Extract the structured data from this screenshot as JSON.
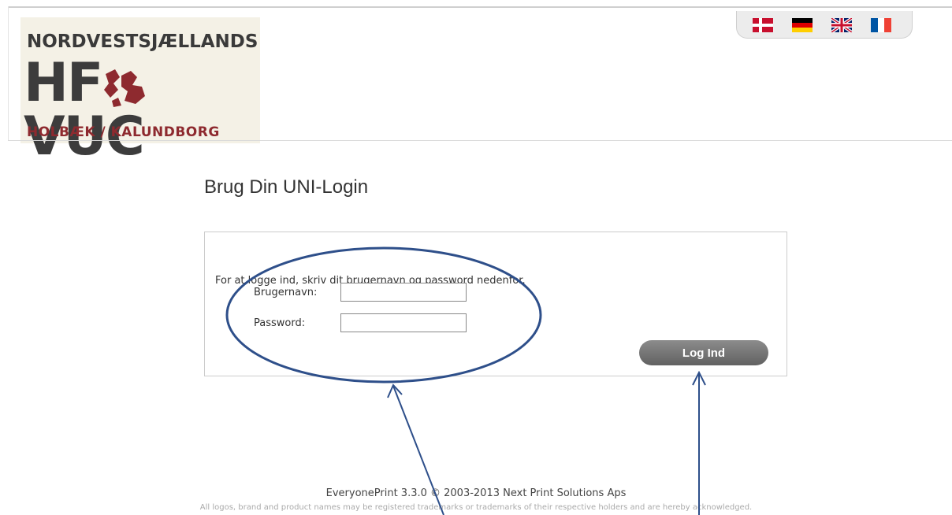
{
  "logo": {
    "line1": "NORDVESTSJÆLLANDS",
    "hf": "HF",
    "vuc": "VUC",
    "line3": "HOLBÆK / KALUNDBORG",
    "colors": {
      "dark": "#3c3c3c",
      "red": "#8e2a2f",
      "bg": "#f4f1e6"
    }
  },
  "languages": [
    {
      "code": "da",
      "icon": "danish-flag-icon"
    },
    {
      "code": "de",
      "icon": "german-flag-icon"
    },
    {
      "code": "en",
      "icon": "uk-flag-icon"
    },
    {
      "code": "fr",
      "icon": "french-flag-icon"
    }
  ],
  "page": {
    "title": "Brug Din UNI-Login"
  },
  "login": {
    "intro": "For at logge ind, skriv dit brugernavn og password nedenfor.",
    "username_label": "Brugernavn:",
    "username_value": "",
    "password_label": "Password:",
    "password_value": "",
    "submit_label": "Log Ind"
  },
  "footer": {
    "version": "EveryonePrint 3.3.0 © 2003-2013 Next Print Solutions Aps",
    "disclaimer": "All logos, brand and product names may be registered trademarks or trademarks of their respective holders and are hereby acknowledged."
  },
  "annotation": {
    "color": "#2e4f8a"
  }
}
